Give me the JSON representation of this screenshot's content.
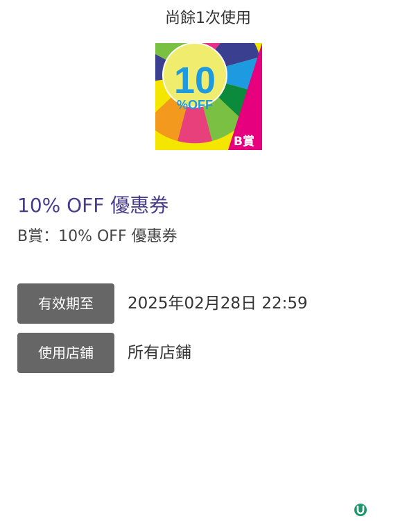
{
  "header": {
    "remaining_uses": "尚餘1次使用"
  },
  "coupon": {
    "image": {
      "icon": "prize-wheel-coupon-icon",
      "big_number": "10",
      "off_text": "%OFF",
      "prize_label": "B賞"
    },
    "title": "10% OFF 優惠券",
    "description": "B賞：10% OFF 優惠券"
  },
  "details": {
    "expiry": {
      "label": "有效期至",
      "value": "2025年02月28日 22:59"
    },
    "stores": {
      "label": "使用店鋪",
      "value": "所有店鋪"
    }
  },
  "footer": {
    "brand_icon": "u-brand-icon"
  },
  "colors": {
    "title": "#4a3c8c",
    "tag_bg": "#666666",
    "magenta": "#e6007e",
    "yellow": "#f5e600",
    "wheel_center": "#f0ec6e",
    "number_blue": "#1e9be0",
    "brand_green": "#1a9a6a"
  }
}
